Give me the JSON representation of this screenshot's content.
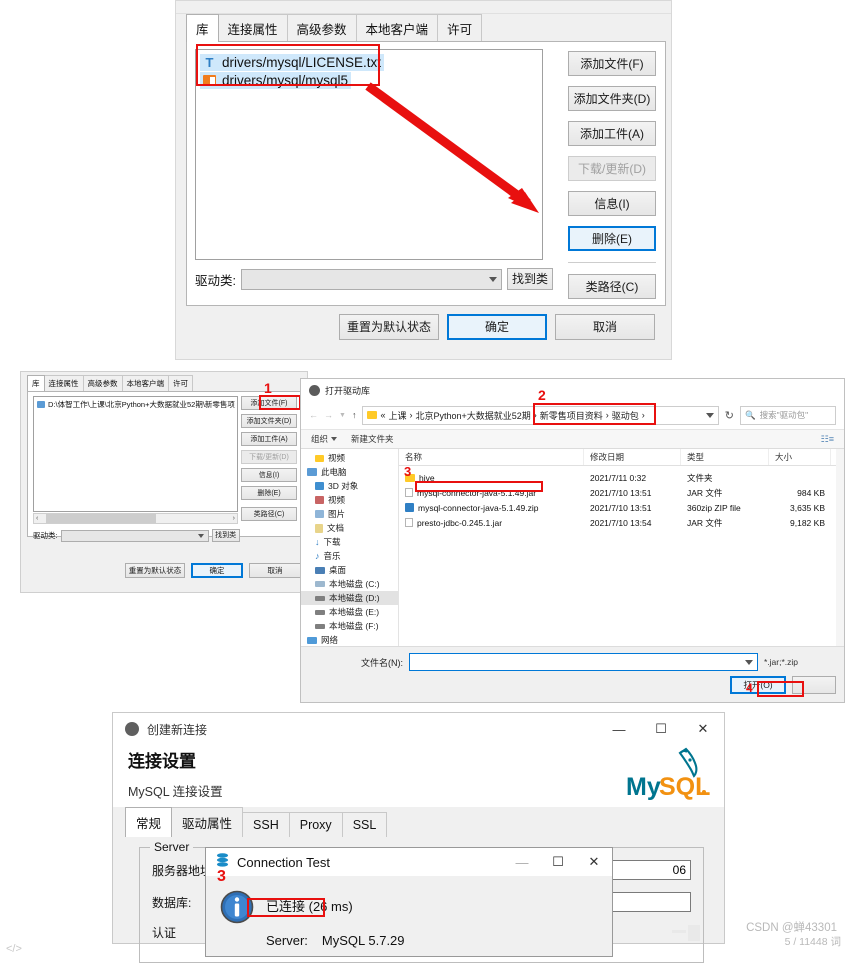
{
  "shot1": {
    "name": "driver-library-dialog",
    "tabs": [
      {
        "label": "库",
        "active": true
      },
      {
        "label": "连接属性",
        "active": false
      },
      {
        "label": "高级参数",
        "active": false
      },
      {
        "label": "本地客户端",
        "active": false
      },
      {
        "label": "许可",
        "active": false
      }
    ],
    "files": [
      {
        "icon": "text-file-icon",
        "label": "drivers/mysql/LICENSE.txt"
      },
      {
        "icon": "archive-file-icon",
        "label": "drivers/mysql/mysql5"
      }
    ],
    "buttons": [
      {
        "label": "添加文件(F)",
        "state": "normal"
      },
      {
        "label": "添加文件夹(D)",
        "state": "normal"
      },
      {
        "label": "添加工件(A)",
        "state": "normal"
      },
      {
        "label": "下载/更新(D)",
        "state": "disabled"
      },
      {
        "label": "信息(I)",
        "state": "normal"
      },
      {
        "label": "删除(E)",
        "state": "focus"
      },
      {
        "label": "类路径(C)",
        "state": "normal"
      }
    ],
    "driver_class_label": "驱动类:",
    "driver_class_value": "",
    "find_class_button": "找到类",
    "footer": [
      {
        "label": "重置为默认状态",
        "state": "normal"
      },
      {
        "label": "确定",
        "state": "focus"
      },
      {
        "label": "取消",
        "state": "normal"
      }
    ]
  },
  "shot2mini": {
    "name": "driver-library-dialog-small",
    "tabs": [
      {
        "label": "库",
        "active": true
      },
      {
        "label": "连接属性",
        "active": false
      },
      {
        "label": "高级参数",
        "active": false
      },
      {
        "label": "本地客户端",
        "active": false
      },
      {
        "label": "许可",
        "active": false
      }
    ],
    "files": [
      {
        "icon": "jar-file-icon",
        "label": "D:\\体智工作\\上课\\北京Python+大数据就业52期\\新零售项"
      }
    ],
    "buttons": [
      {
        "label": "添加文件(F)",
        "state": "normal"
      },
      {
        "label": "添加文件夹(D)",
        "state": "normal"
      },
      {
        "label": "添加工件(A)",
        "state": "normal"
      },
      {
        "label": "下载/更新(D)",
        "state": "disabled"
      },
      {
        "label": "信息(I)",
        "state": "normal"
      },
      {
        "label": "删除(E)",
        "state": "normal"
      },
      {
        "label": "类路径(C)",
        "state": "normal"
      }
    ],
    "driver_class_label": "驱动类:",
    "driver_class_value": "",
    "find_class_button": "找到类",
    "footer": [
      {
        "label": "重置为默认状态",
        "state": "normal"
      },
      {
        "label": "确定",
        "state": "focus"
      },
      {
        "label": "取消",
        "state": "normal"
      }
    ],
    "annotation": "1"
  },
  "explorer": {
    "name": "open-driver-library-explorer",
    "title": "打开驱动库",
    "nav": {
      "back_icon": "back-arrow-icon",
      "forward_icon": "forward-arrow-icon",
      "recent_icon": "chevron-down-icon",
      "up_icon": "up-arrow-icon"
    },
    "breadcrumb": [
      "«",
      "上课",
      "北京Python+大数据就业52期",
      "新零售项目资料",
      "驱动包",
      ""
    ],
    "refresh_icon": "refresh-icon",
    "search_placeholder": "搜索\"驱动包\"",
    "toolbar": [
      {
        "label": "组织",
        "caret": true
      },
      {
        "label": "新建文件夹",
        "caret": false
      }
    ],
    "view_icon": "view-layout-icon",
    "sidebar": [
      {
        "label": "视频",
        "icon": "folder-icon",
        "level": 1,
        "selected": false
      },
      {
        "label": "此电脑",
        "icon": "this-pc-icon",
        "level": 0,
        "selected": false
      },
      {
        "label": "3D 对象",
        "icon": "3d-objects-icon",
        "level": 1,
        "selected": false
      },
      {
        "label": "视频",
        "icon": "videos-icon",
        "level": 1,
        "selected": false
      },
      {
        "label": "图片",
        "icon": "pictures-icon",
        "level": 1,
        "selected": false
      },
      {
        "label": "文档",
        "icon": "documents-icon",
        "level": 1,
        "selected": false
      },
      {
        "label": "下载",
        "icon": "downloads-icon",
        "level": 1,
        "selected": false
      },
      {
        "label": "音乐",
        "icon": "music-icon",
        "level": 1,
        "selected": false
      },
      {
        "label": "桌面",
        "icon": "desktop-icon",
        "level": 1,
        "selected": false
      },
      {
        "label": "本地磁盘 (C:)",
        "icon": "system-drive-icon",
        "level": 1,
        "selected": false
      },
      {
        "label": "本地磁盘 (D:)",
        "icon": "drive-icon",
        "level": 1,
        "selected": true
      },
      {
        "label": "本地磁盘 (E:)",
        "icon": "drive-icon",
        "level": 1,
        "selected": false
      },
      {
        "label": "本地磁盘 (F:)",
        "icon": "drive-icon",
        "level": 1,
        "selected": false
      },
      {
        "label": "网络",
        "icon": "network-icon",
        "level": 0,
        "selected": false
      }
    ],
    "columns": [
      "名称",
      "修改日期",
      "类型",
      "大小"
    ],
    "rows": [
      {
        "icon": "folder-icon",
        "name": "hive",
        "date": "2021/7/11 0:32",
        "type": "文件夹",
        "size": ""
      },
      {
        "icon": "jar-file-icon",
        "name": "mysql-connector-java-5.1.49.jar",
        "date": "2021/7/10 13:51",
        "type": "JAR 文件",
        "size": "984 KB"
      },
      {
        "icon": "zip-file-icon",
        "name": "mysql-connector-java-5.1.49.zip",
        "date": "2021/7/10 13:51",
        "type": "360zip ZIP file",
        "size": "3,635 KB"
      },
      {
        "icon": "jar-file-icon",
        "name": "presto-jdbc-0.245.1.jar",
        "date": "2021/7/10 13:54",
        "type": "JAR 文件",
        "size": "9,182 KB"
      }
    ],
    "filename_label": "文件名(N):",
    "filename_value": "",
    "filter_value": "*.jar;*.zip",
    "open_button": "打开(O)",
    "annotations": {
      "breadcrumb": "2",
      "file_row": "3",
      "open_button": "4"
    }
  },
  "shot3": {
    "name": "create-new-connection-dialog",
    "title": "创建新连接",
    "app_icon": "dbeaver-icon",
    "window_controls": {
      "minimize": "—",
      "maximize": "☐",
      "close": "✕"
    },
    "heading": "连接设置",
    "subheading": "MySQL 连接设置",
    "logo_text": "MySQL",
    "tabs": [
      {
        "label": "常规",
        "active": true
      },
      {
        "label": "驱动属性",
        "active": false
      },
      {
        "label": "SSH",
        "active": false
      },
      {
        "label": "Proxy",
        "active": false
      },
      {
        "label": "SSL",
        "active": false
      }
    ],
    "group_label": "Server",
    "fields": [
      {
        "label": "服务器地址:",
        "value": "06"
      },
      {
        "label": "数据库:",
        "value": ""
      }
    ],
    "third_label": "认证"
  },
  "ctest": {
    "name": "connection-test-dialog",
    "title": "Connection Test",
    "app_icon": "database-icon",
    "info_icon": "info-icon",
    "message": "已连接 (26 ms)",
    "detail_label": "Server:",
    "detail_value": "MySQL 5.7.29",
    "window_controls": {
      "minimize": "—",
      "maximize": "☐",
      "close": "✕"
    },
    "annotation": "3"
  },
  "page": {
    "watermark": "CSDN @蝉43301",
    "page_count": "5 / 11448 词",
    "code_icon": "code-icon"
  },
  "colors": {
    "accent": "#0078d7",
    "annotation_red": "#e8100f",
    "selection_blue": "#cfe8fb",
    "mysql_orange": "#f29111",
    "mysql_teal": "#00758f"
  }
}
